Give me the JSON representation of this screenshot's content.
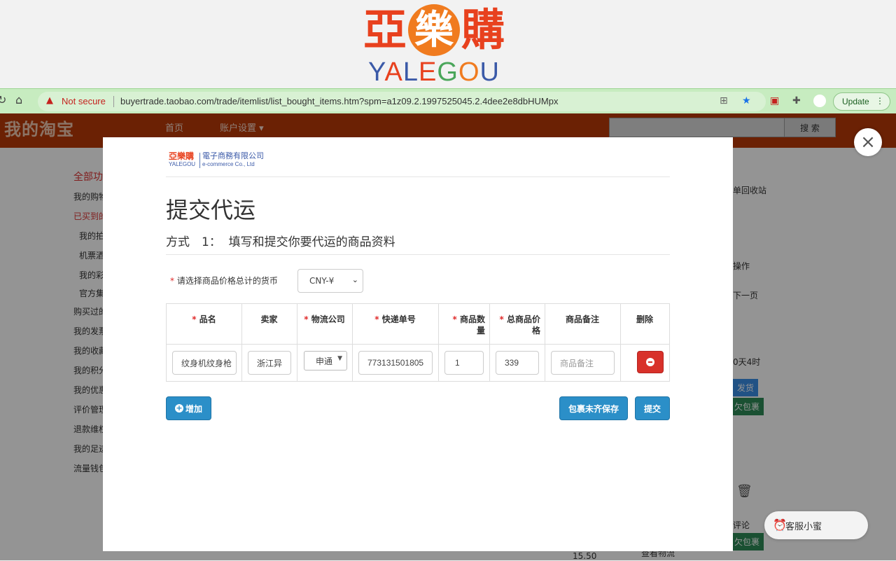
{
  "banner": {
    "logo_cn": [
      "亞",
      "樂",
      "購"
    ],
    "logo_en": [
      "Y",
      "A",
      "L",
      "E",
      "G",
      "O",
      "U"
    ]
  },
  "browser": {
    "not_secure": "Not secure",
    "url": "buyertrade.taobao.com/trade/itemlist/list_bought_items.htm?spm=a1z09.2.1997525045.2.4dee2e8dbHUMpx",
    "update_label": "Update"
  },
  "taobao": {
    "logo": "我的淘宝",
    "nav": [
      "首页",
      "账户设置 ▾"
    ],
    "search_button": "搜 索"
  },
  "background_page": {
    "sidebar": [
      "全部功",
      "我的购物",
      "已买到的",
      "我的拍",
      "机票酒",
      "我的彩",
      "官方集",
      "购买过的",
      "我的发票",
      "我的收藏",
      "我的积分",
      "我的优惠",
      "评价管理",
      "退款维权",
      "我的足迹",
      "流量钱包"
    ],
    "right_fragments": [
      "单回收站",
      "操作",
      "下一页",
      "0天4时",
      "发货",
      "欠包裹",
      "评论",
      "欠包裹",
      "查看物流",
      "15.50"
    ]
  },
  "chat_widget": {
    "label": "客服小蜜"
  },
  "modal": {
    "company_logo_cn": "亞樂購",
    "company_logo_en": "YALEGOU",
    "company_name": "電子商務有限公司",
    "company_name_en": "e-commerce Co., Ltd",
    "title": "提交代运",
    "method": "方式　1：  填写和提交你要代运的商品资料",
    "currency_label": "请选择商品价格总计的货币",
    "currency_value": "CNY-¥",
    "table": {
      "headers": [
        "品名",
        "卖家",
        "物流公司",
        "快递单号",
        "商品数量",
        "总商品价格",
        "商品备注",
        "删除"
      ],
      "row": {
        "product_name": "纹身机纹身枪",
        "seller": "浙江异",
        "courier": "申通",
        "tracking_number": "773131501805",
        "quantity": "1",
        "total_price": "339",
        "note_placeholder": "商品备注"
      }
    },
    "add_button": "增加",
    "save_button": "包裹未齐保存",
    "submit_button": "提交"
  },
  "colors": {
    "taobao_header": "#b83a07",
    "primary_button": "#2b8fc8",
    "delete_button": "#d8312a",
    "required_mark": "#e02b2b"
  }
}
